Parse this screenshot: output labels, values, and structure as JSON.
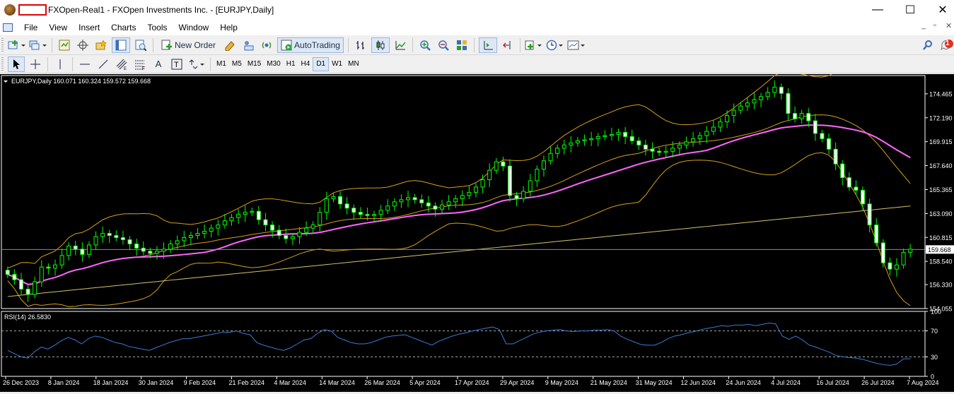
{
  "window": {
    "title": "FXOpen-Real1 - FXOpen Investments Inc. - [EURJPY,Daily]",
    "minimize": "—",
    "maximize": "☐",
    "close": "✕"
  },
  "menu": [
    "File",
    "View",
    "Insert",
    "Charts",
    "Tools",
    "Window",
    "Help"
  ],
  "mdi": {
    "minimize": "_",
    "restore": "▫",
    "close": "✕"
  },
  "toolbar": {
    "new_order": "New Order",
    "auto_trading": "AutoTrading",
    "notification_count": "1"
  },
  "timeframes": [
    "M1",
    "M5",
    "M15",
    "M30",
    "H1",
    "H4",
    "D1",
    "W1",
    "MN"
  ],
  "active_timeframe": "D1",
  "colors": {
    "bull_candle": "#00ff00",
    "bear_candle": "#ffffff",
    "bollinger": "#d4a017",
    "ma_fast": "#ff66ff",
    "ma_slow": "#d4c46a",
    "rsi": "#3a7bd5"
  },
  "chart_data": [
    {
      "type": "candlestick",
      "title": "EURJPY,Daily  160.071 160.324 159.572 159.668",
      "symbol": "EURJPY",
      "period": "Daily",
      "ohlc_label": "160.071 160.324 159.572 159.668",
      "current_price": "159.668",
      "ylim": [
        154.055,
        176.2
      ],
      "yticks": [
        "174.465",
        "172.190",
        "169.915",
        "167.640",
        "165.365",
        "163.090",
        "160.815",
        "158.540",
        "156.330",
        "154.055"
      ],
      "xticks": [
        "26 Dec 2023",
        "8 Jan 2024",
        "18 Jan 2024",
        "30 Jan 2024",
        "9 Feb 2024",
        "21 Feb 2024",
        "4 Mar 2024",
        "14 Mar 2024",
        "26 Mar 2024",
        "5 Apr 2024",
        "17 Apr 2024",
        "29 Apr 2024",
        "9 May 2024",
        "21 May 2024",
        "31 May 2024",
        "12 Jun 2024",
        "24 Jun 2024",
        "4 Jul 2024",
        "16 Jul 2024",
        "26 Jul 2024",
        "7 Aug 2024"
      ],
      "series_closes": [
        157.3,
        156.8,
        155.9,
        155.4,
        156.6,
        158.0,
        157.9,
        158.2,
        159.1,
        160.0,
        159.7,
        159.2,
        160.1,
        160.9,
        161.2,
        161.0,
        160.8,
        160.6,
        160.2,
        159.8,
        159.5,
        159.3,
        159.5,
        159.7,
        160.2,
        160.5,
        160.8,
        161.0,
        161.2,
        161.4,
        161.7,
        162.0,
        162.4,
        162.7,
        163.0,
        163.2,
        163.3,
        162.5,
        162.0,
        161.5,
        161.0,
        160.7,
        160.9,
        161.3,
        161.7,
        162.0,
        163.2,
        164.5,
        164.7,
        164.0,
        163.6,
        163.2,
        163.0,
        162.9,
        163.0,
        163.4,
        163.8,
        164.2,
        164.4,
        164.6,
        164.4,
        164.1,
        163.8,
        163.5,
        163.9,
        164.2,
        164.5,
        164.8,
        165.1,
        165.6,
        166.3,
        167.2,
        168.0,
        167.6,
        164.8,
        164.5,
        165.2,
        166.2,
        167.3,
        168.1,
        168.8,
        169.3,
        169.6,
        169.8,
        170.0,
        170.1,
        170.2,
        170.4,
        170.5,
        170.6,
        170.8,
        170.4,
        170.0,
        169.6,
        169.2,
        169.0,
        168.9,
        169.0,
        169.3,
        169.6,
        169.9,
        170.2,
        170.5,
        170.9,
        171.3,
        171.8,
        172.4,
        172.9,
        173.3,
        173.6,
        173.9,
        174.2,
        174.6,
        175.1,
        174.5,
        172.6,
        172.1,
        172.6,
        171.9,
        170.7,
        170.2,
        169.2,
        167.8,
        166.5,
        165.6,
        165.3,
        164.0,
        162.0,
        160.3,
        158.4,
        157.8,
        158.2,
        159.4,
        159.7
      ],
      "overlays": [
        "Bollinger Bands",
        "Moving Average (fast)",
        "Moving Average (slow)"
      ]
    },
    {
      "type": "line",
      "title": "RSI(14) 26.5830",
      "indicator": "RSI(14)",
      "value_label": "26.5830",
      "ylim": [
        0,
        100
      ],
      "yticks": [
        "100",
        "70",
        "30",
        "0"
      ],
      "levels": [
        70,
        30
      ],
      "values": [
        40,
        35,
        30,
        28,
        38,
        45,
        42,
        48,
        55,
        60,
        56,
        50,
        58,
        62,
        60,
        56,
        52,
        50,
        46,
        44,
        42,
        40,
        44,
        48,
        52,
        55,
        58,
        58,
        60,
        62,
        64,
        66,
        68,
        68,
        70,
        66,
        64,
        52,
        48,
        45,
        42,
        40,
        44,
        50,
        56,
        58,
        66,
        72,
        70,
        60,
        56,
        52,
        50,
        50,
        52,
        56,
        60,
        62,
        63,
        64,
        60,
        56,
        52,
        48,
        54,
        58,
        62,
        65,
        67,
        70,
        72,
        74,
        76,
        72,
        50,
        50,
        55,
        60,
        65,
        68,
        70,
        71,
        72,
        70,
        69,
        70,
        70,
        71,
        71,
        72,
        70,
        62,
        57,
        53,
        49,
        48,
        48,
        52,
        58,
        62,
        64,
        67,
        69,
        72,
        74,
        76,
        78,
        77,
        79,
        79,
        80,
        78,
        80,
        82,
        81,
        62,
        57,
        62,
        56,
        48,
        45,
        41,
        37,
        32,
        30,
        29,
        28,
        26,
        23,
        20,
        18,
        17,
        19,
        27,
        27
      ]
    }
  ]
}
